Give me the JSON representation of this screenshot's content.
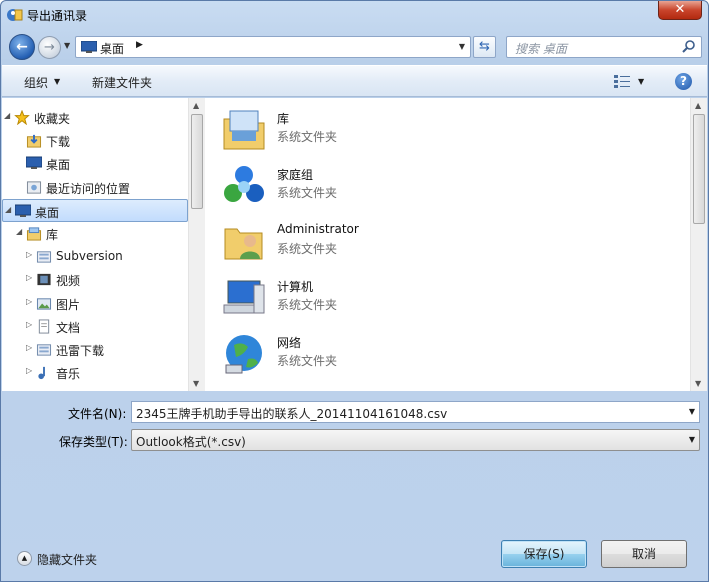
{
  "window": {
    "title": "导出通讯录",
    "close_glyph": "✕"
  },
  "address_bar": {
    "location": "桌面",
    "separator": "▶"
  },
  "search": {
    "placeholder": "搜索 桌面"
  },
  "toolbar": {
    "organize_label": "组织",
    "new_folder_label": "新建文件夹",
    "help_glyph": "?"
  },
  "nav_pane": {
    "items": [
      {
        "label": "收藏夹",
        "icon": "star-icon",
        "level": 0,
        "expanded": true
      },
      {
        "label": "下载",
        "icon": "download-folder-icon",
        "level": 1
      },
      {
        "label": "桌面",
        "icon": "desktop-icon",
        "level": 1
      },
      {
        "label": "最近访问的位置",
        "icon": "recent-places-icon",
        "level": 1
      },
      {
        "label": "桌面",
        "icon": "desktop-icon",
        "level": 0,
        "expanded": true,
        "selected": true
      },
      {
        "label": "库",
        "icon": "library-icon",
        "level": 1,
        "expanded": true
      },
      {
        "label": "Subversion",
        "icon": "library-doc-icon",
        "level": 2
      },
      {
        "label": "视频",
        "icon": "video-library-icon",
        "level": 2
      },
      {
        "label": "图片",
        "icon": "pictures-library-icon",
        "level": 2
      },
      {
        "label": "文档",
        "icon": "documents-library-icon",
        "level": 2
      },
      {
        "label": "迅雷下载",
        "icon": "library-doc-icon",
        "level": 2
      },
      {
        "label": "音乐",
        "icon": "music-library-icon",
        "level": 2
      }
    ]
  },
  "files": [
    {
      "name": "库",
      "type": "系统文件夹",
      "icon": "library-icon"
    },
    {
      "name": "家庭组",
      "type": "系统文件夹",
      "icon": "homegroup-icon"
    },
    {
      "name": "Administrator",
      "type": "系统文件夹",
      "icon": "user-folder-icon"
    },
    {
      "name": "计算机",
      "type": "系统文件夹",
      "icon": "computer-icon"
    },
    {
      "name": "网络",
      "type": "系统文件夹",
      "icon": "network-icon"
    }
  ],
  "form": {
    "filename_label": "文件名(N):",
    "filename_value": "2345王牌手机助手导出的联系人_20141104161048.csv",
    "filetype_label": "保存类型(T):",
    "filetype_value": "Outlook格式(*.csv)"
  },
  "footer": {
    "hide_folders_label": "隐藏文件夹",
    "save_label": "保存(S)",
    "cancel_label": "取消"
  }
}
